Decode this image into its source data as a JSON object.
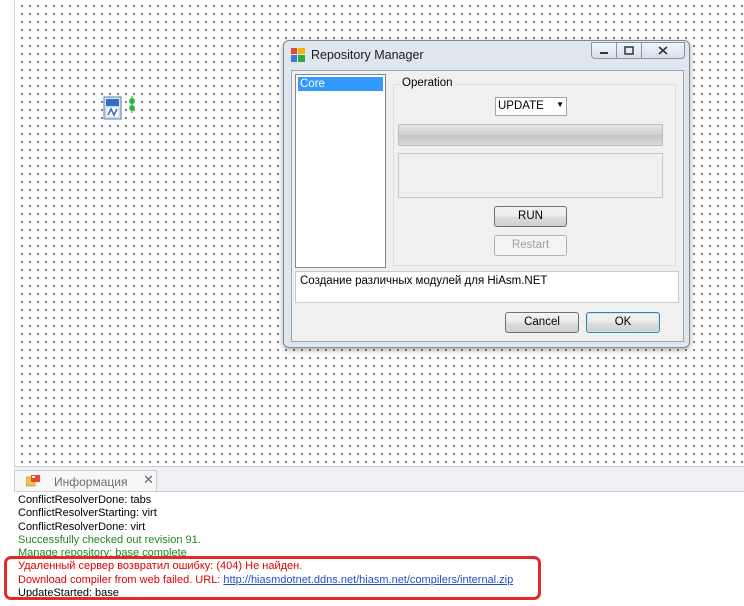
{
  "dialog": {
    "title": "Repository Manager",
    "list_items": [
      "Core"
    ],
    "group_label": "Operation",
    "operation_selected": "UPDATE",
    "run_label": "RUN",
    "restart_label": "Restart",
    "description": "Создание различных модулей для HiAsm.NET",
    "cancel_label": "Cancel",
    "ok_label": "OK"
  },
  "panel": {
    "tab_label": "Информация",
    "log": [
      {
        "text": "ConflictResolverDone: tabs",
        "status": "normal"
      },
      {
        "text": "ConflictResolverStarting: virt",
        "status": "normal"
      },
      {
        "text": "ConflictResolverDone: virt",
        "status": "normal"
      },
      {
        "text": "Successfully checked out revision 91.",
        "status": "success"
      },
      {
        "text": "Manage repository:   base complete",
        "status": "success"
      },
      {
        "text": "Удаленный сервер возвратил ошибку: (404) Не найден.",
        "status": "error"
      },
      {
        "text": "Download compiler from web failed. URL: ",
        "status": "error",
        "link": "http://hiasmdotnet.ddns.net/hiasm.net/compilers/internal.zip"
      },
      {
        "text": "UpdateStarted:   base",
        "status": "normal"
      }
    ]
  },
  "colors": {
    "success": "#1c8a1c",
    "error": "#e00000",
    "highlight": "#e32a2a",
    "selection": "#3399ff"
  }
}
